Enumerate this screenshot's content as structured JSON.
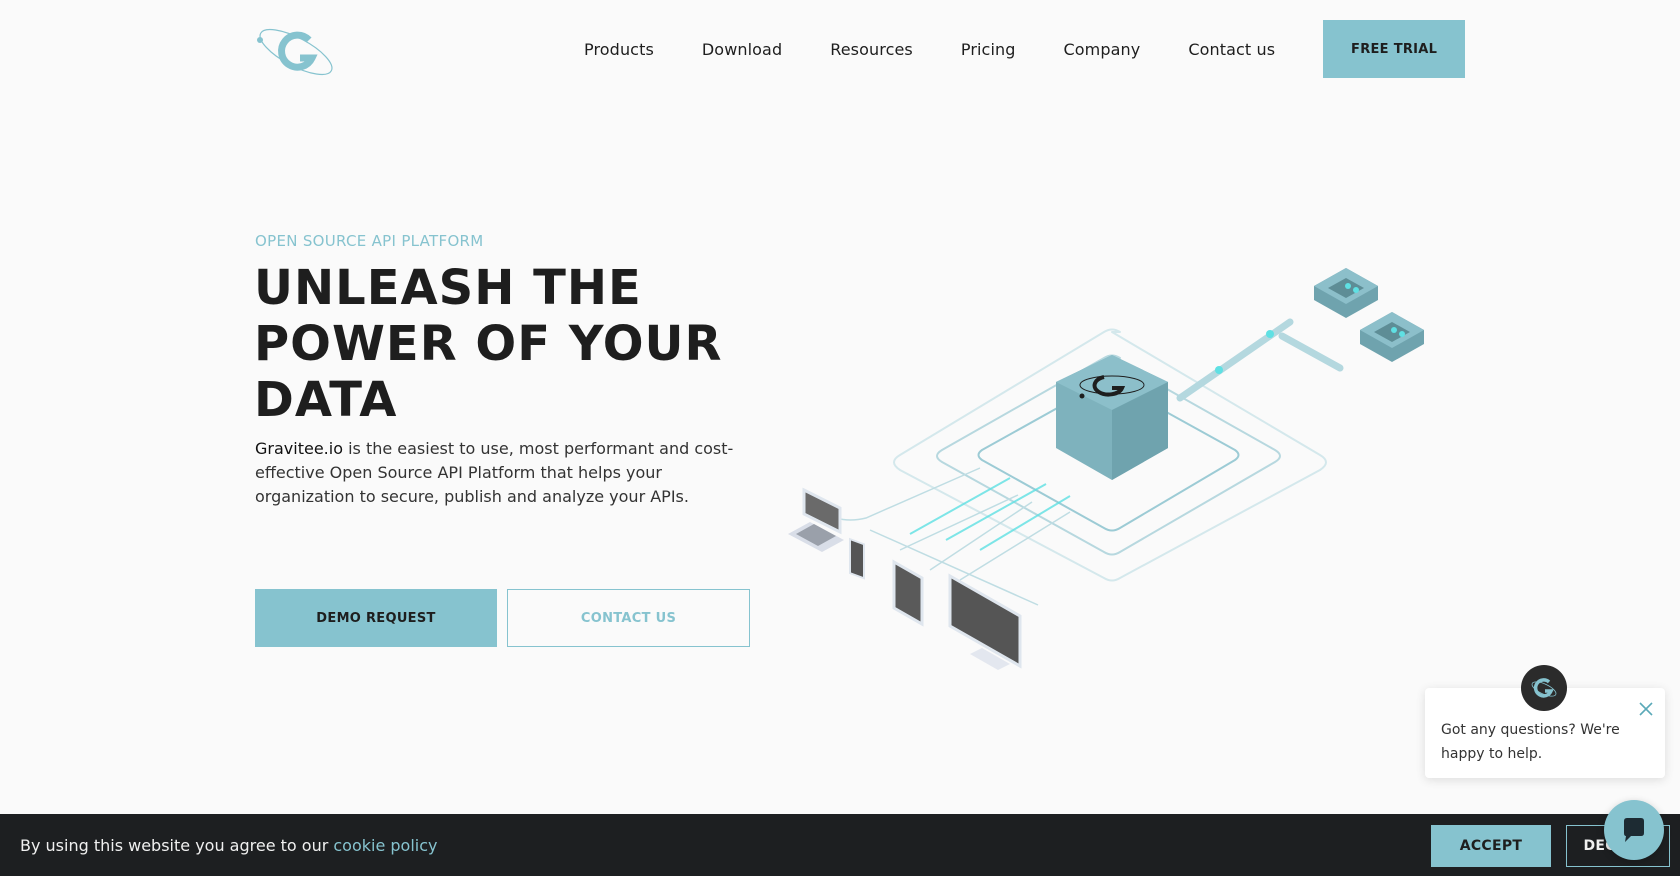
{
  "header": {
    "logo_icon": "gravitee-logo-icon",
    "nav": [
      {
        "label": "Products"
      },
      {
        "label": "Download"
      },
      {
        "label": "Resources"
      },
      {
        "label": "Pricing"
      },
      {
        "label": "Company"
      },
      {
        "label": "Contact us"
      }
    ],
    "cta_label": "FREE TRIAL"
  },
  "hero": {
    "eyebrow": "OPEN SOURCE API PLATFORM",
    "headline_lines": [
      "UNLEASH THE",
      "POWER OF YOUR",
      "DATA"
    ],
    "lead_brand": "Gravitee.io",
    "lead_rest": " is the easiest to use, most performant and cost-effective Open Source API Platform that helps your organization to secure, publish and analyze your APIs.",
    "primary_button": "DEMO REQUEST",
    "secondary_button": "CONTACT US",
    "illustration_icon": "api-platform-isometric-illustration"
  },
  "chat": {
    "message": "Got any questions? We're happy to help.",
    "avatar_icon": "gravitee-avatar-icon",
    "close_icon": "close-icon",
    "launcher_icon": "chat-icon"
  },
  "cookie": {
    "text": "By using this website you agree to our ",
    "link": "cookie policy",
    "accept": "ACCEPT",
    "decline": "DECLINE"
  },
  "colors": {
    "accent": "#86c3cf",
    "background": "#fafafa",
    "banner": "#1d1f21",
    "text": "#1e1e1e"
  }
}
